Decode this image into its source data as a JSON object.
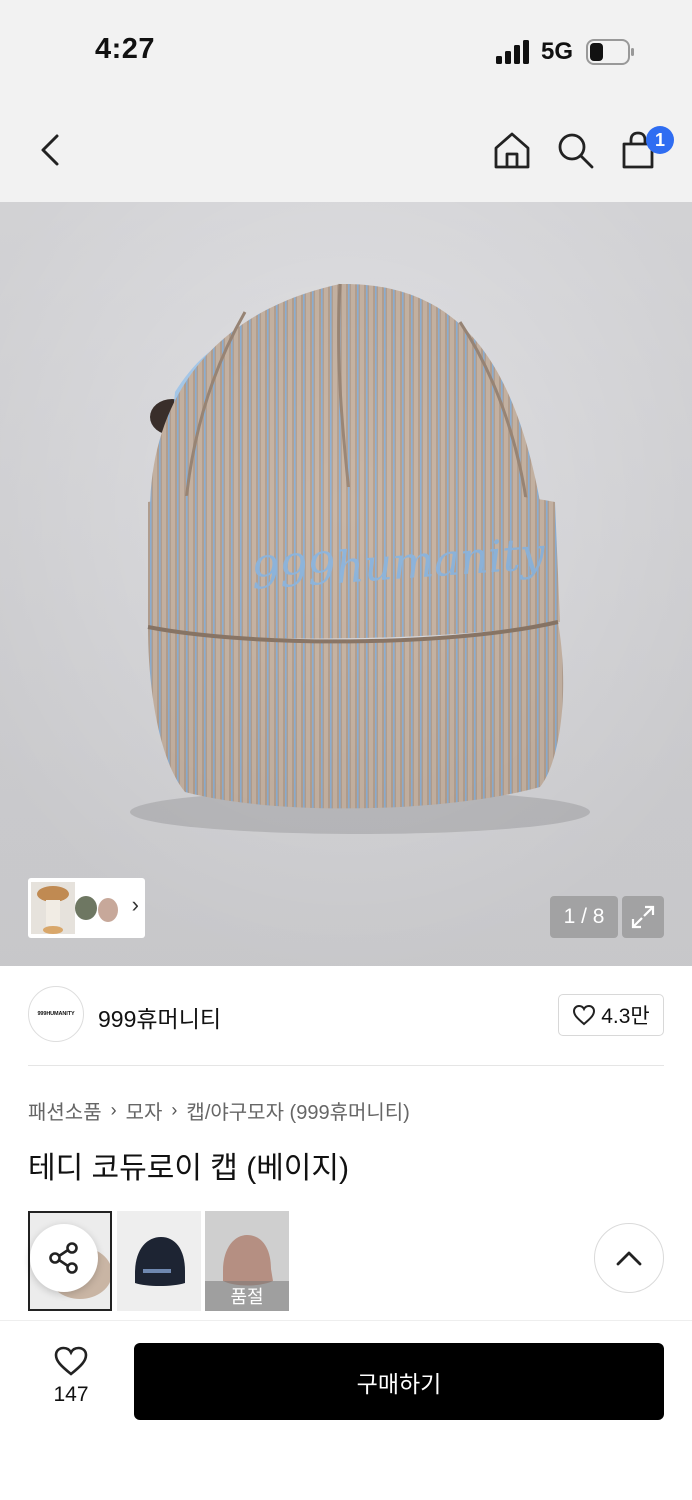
{
  "status_bar": {
    "time": "4:27",
    "network": "5G"
  },
  "nav": {
    "cart_count": "1"
  },
  "gallery": {
    "counter": "1 / 8"
  },
  "brand": {
    "logo_text": "999HUMANITY",
    "name": "999휴머니티",
    "like_count": "4.3만"
  },
  "breadcrumb": [
    "패션소품",
    "모자",
    "캡/야구모자 (999휴머니티)"
  ],
  "product": {
    "title": "테디 코듀로이 캡 (베이지)",
    "hat_embroidery": "999humanity"
  },
  "options": [
    {
      "label": "베이지",
      "sold_out": false
    },
    {
      "label": "네이비",
      "sold_out": false
    },
    {
      "label": "핑크",
      "sold_out": true,
      "sold_out_text": "품절"
    }
  ],
  "bottom_bar": {
    "wish_count": "147",
    "buy_label": "구매하기"
  },
  "colors": {
    "accent_blue": "#2f6df2",
    "buy_button": "#000000"
  }
}
